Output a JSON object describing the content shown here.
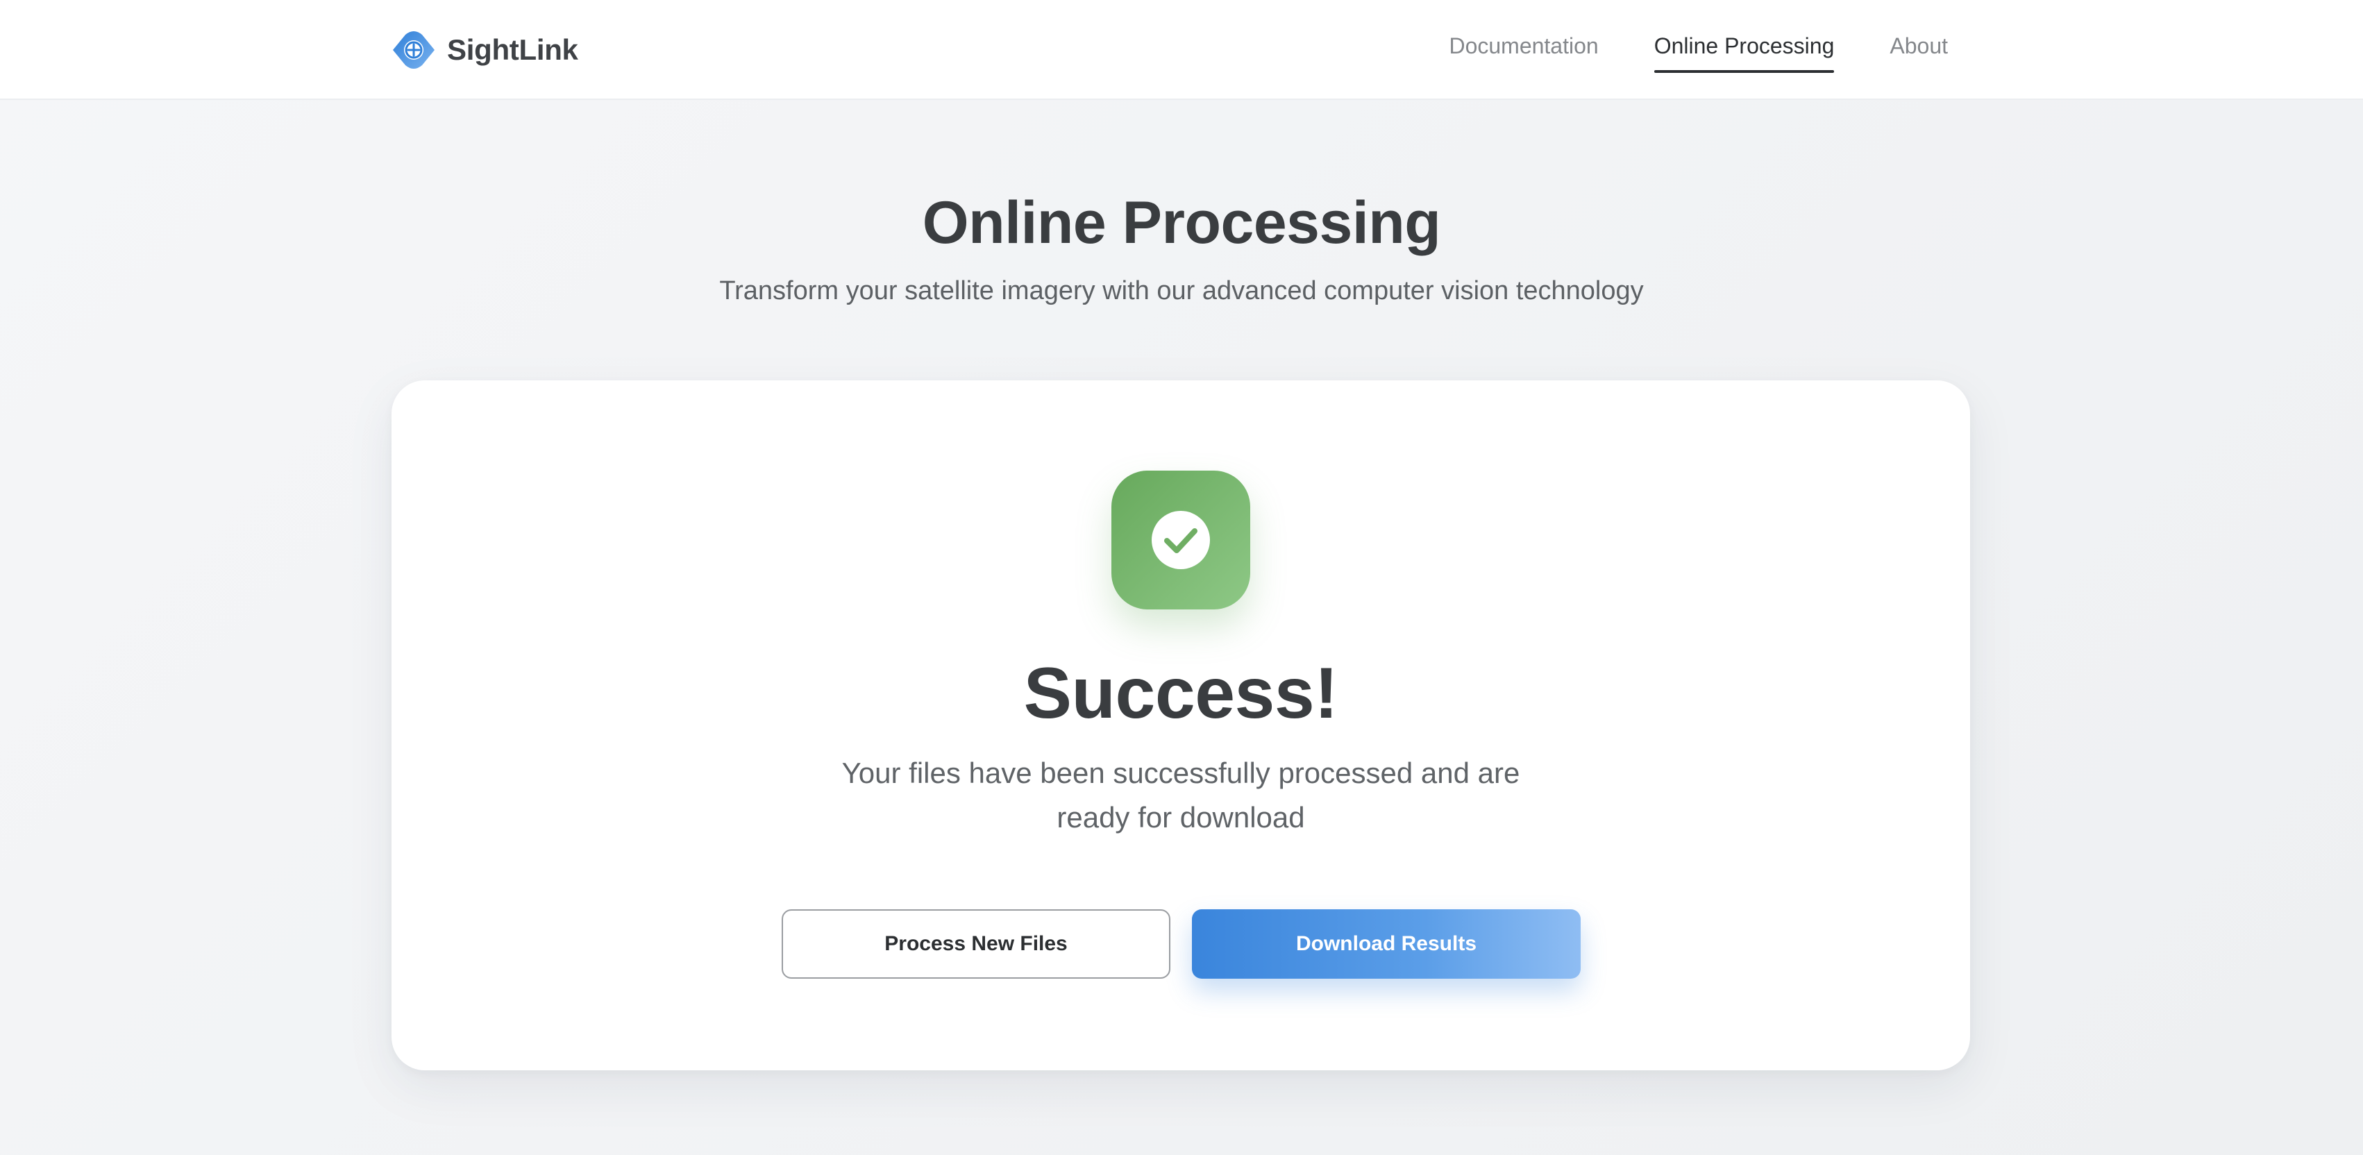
{
  "header": {
    "brand_name": "SightLink",
    "brand_icon": "eye-crosshair-icon",
    "nav": [
      {
        "label": "Documentation",
        "active": false
      },
      {
        "label": "Online Processing",
        "active": true
      },
      {
        "label": "About",
        "active": false
      }
    ]
  },
  "hero": {
    "title": "Online Processing",
    "subtitle": "Transform your satellite imagery with our advanced computer vision technology"
  },
  "result": {
    "icon": "check-circle-icon",
    "title": "Success!",
    "message": "Your files have been successfully processed and are ready for download",
    "buttons": {
      "secondary_label": "Process New Files",
      "primary_label": "Download Results"
    }
  },
  "colors": {
    "accent_blue": "#3a85dc",
    "success_green": "#67a95c",
    "text_dark": "#3a3d40"
  }
}
